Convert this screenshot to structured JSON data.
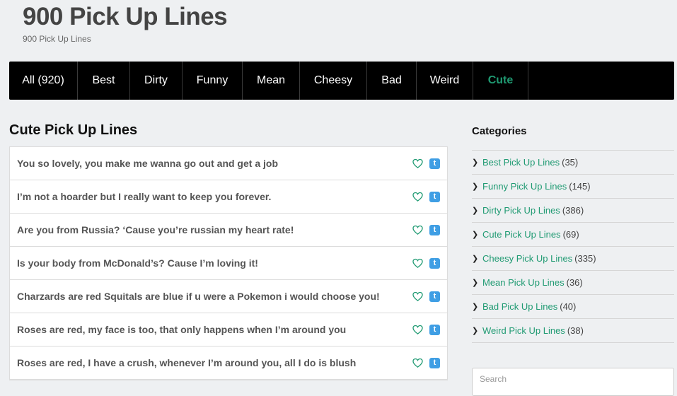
{
  "header": {
    "title": "900 Pick Up Lines",
    "tagline": "900 Pick Up Lines"
  },
  "nav": {
    "items": [
      {
        "label": "All (920)",
        "active": false
      },
      {
        "label": "Best",
        "active": false
      },
      {
        "label": "Dirty",
        "active": false
      },
      {
        "label": "Funny",
        "active": false
      },
      {
        "label": "Mean",
        "active": false
      },
      {
        "label": "Cheesy",
        "active": false
      },
      {
        "label": "Bad",
        "active": false
      },
      {
        "label": "Weird",
        "active": false
      },
      {
        "label": "Cute",
        "active": true
      }
    ]
  },
  "main": {
    "heading": "Cute Pick Up Lines",
    "lines": [
      "You so lovely, you make me wanna go out and get a job",
      "I’m not a hoarder but I really want to keep you forever.",
      "Are you from Russia? ‘Cause you’re russian my heart rate!",
      "Is your body from McDonald’s? Cause I’m loving it!",
      "Charzards are red Squitals are blue if u were a Pokemon i would choose you!",
      "Roses are red, my face is too, that only happens when I’m around you",
      "Roses are red, I have a crush, whenever I’m around you, all I do is blush"
    ],
    "icons": {
      "like": "heart-icon",
      "share": "twitter-icon"
    }
  },
  "sidebar": {
    "heading": "Categories",
    "categories": [
      {
        "label": "Best Pick Up Lines",
        "count": "(35)"
      },
      {
        "label": "Funny Pick Up Lines",
        "count": "(145)"
      },
      {
        "label": "Dirty Pick Up Lines",
        "count": "(386)"
      },
      {
        "label": "Cute Pick Up Lines",
        "count": "(69)"
      },
      {
        "label": "Cheesy Pick Up Lines",
        "count": "(335)"
      },
      {
        "label": "Mean Pick Up Lines",
        "count": "(36)"
      },
      {
        "label": "Bad Pick Up Lines",
        "count": "(40)"
      },
      {
        "label": "Weird Pick Up Lines",
        "count": "(38)"
      }
    ],
    "search_placeholder": "Search"
  },
  "colors": {
    "accent": "#1f9a72",
    "nav_bg": "#000000",
    "twitter": "#3f9ee4"
  }
}
